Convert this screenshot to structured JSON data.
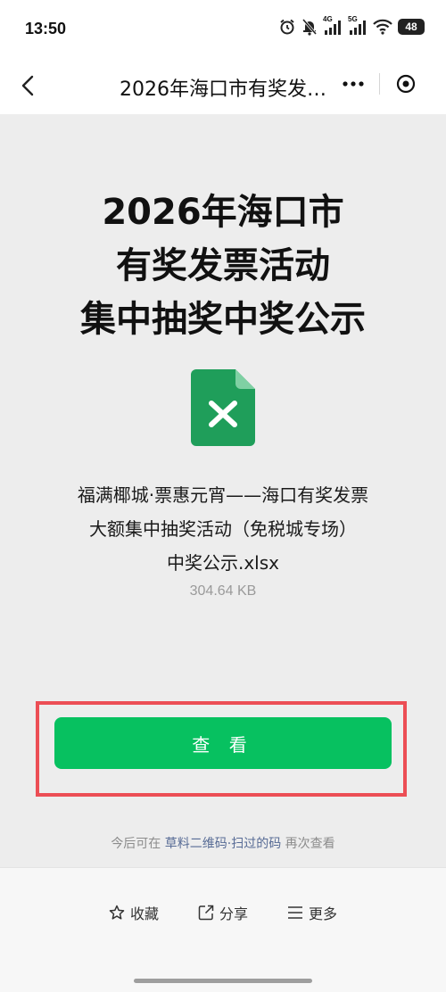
{
  "status_bar": {
    "time": "13:50",
    "network_labels": [
      "4G",
      "5G"
    ],
    "battery": "48"
  },
  "nav": {
    "title": "2026年海口市有奖发票活动集中抽奖中奖公示",
    "back_icon": "chevron-left-icon",
    "more_icon": "more-dots-icon",
    "close_icon": "close-circle-icon"
  },
  "document": {
    "headline_lines": [
      "2026年海口市",
      "有奖发票活动",
      "集中抽奖中奖公示"
    ],
    "file_icon": "excel-file-icon",
    "file_name_lines": [
      "福满椰城·票惠元宵——海口有奖发票",
      "大额集中抽奖活动（免税城专场）",
      "中奖公示.xlsx"
    ],
    "file_size": "304.64 KB",
    "view_button": "查 看"
  },
  "hint": {
    "prefix": "今后可在 ",
    "link": "草料二维码·扫过的码",
    "suffix": " 再次查看"
  },
  "bottom_actions": {
    "favorite": "收藏",
    "share": "分享",
    "more": "更多"
  },
  "colors": {
    "primary_green": "#07c160",
    "excel_green": "#1f9e5a",
    "highlight_red": "#ec4e55",
    "link_blue": "#576b95"
  }
}
